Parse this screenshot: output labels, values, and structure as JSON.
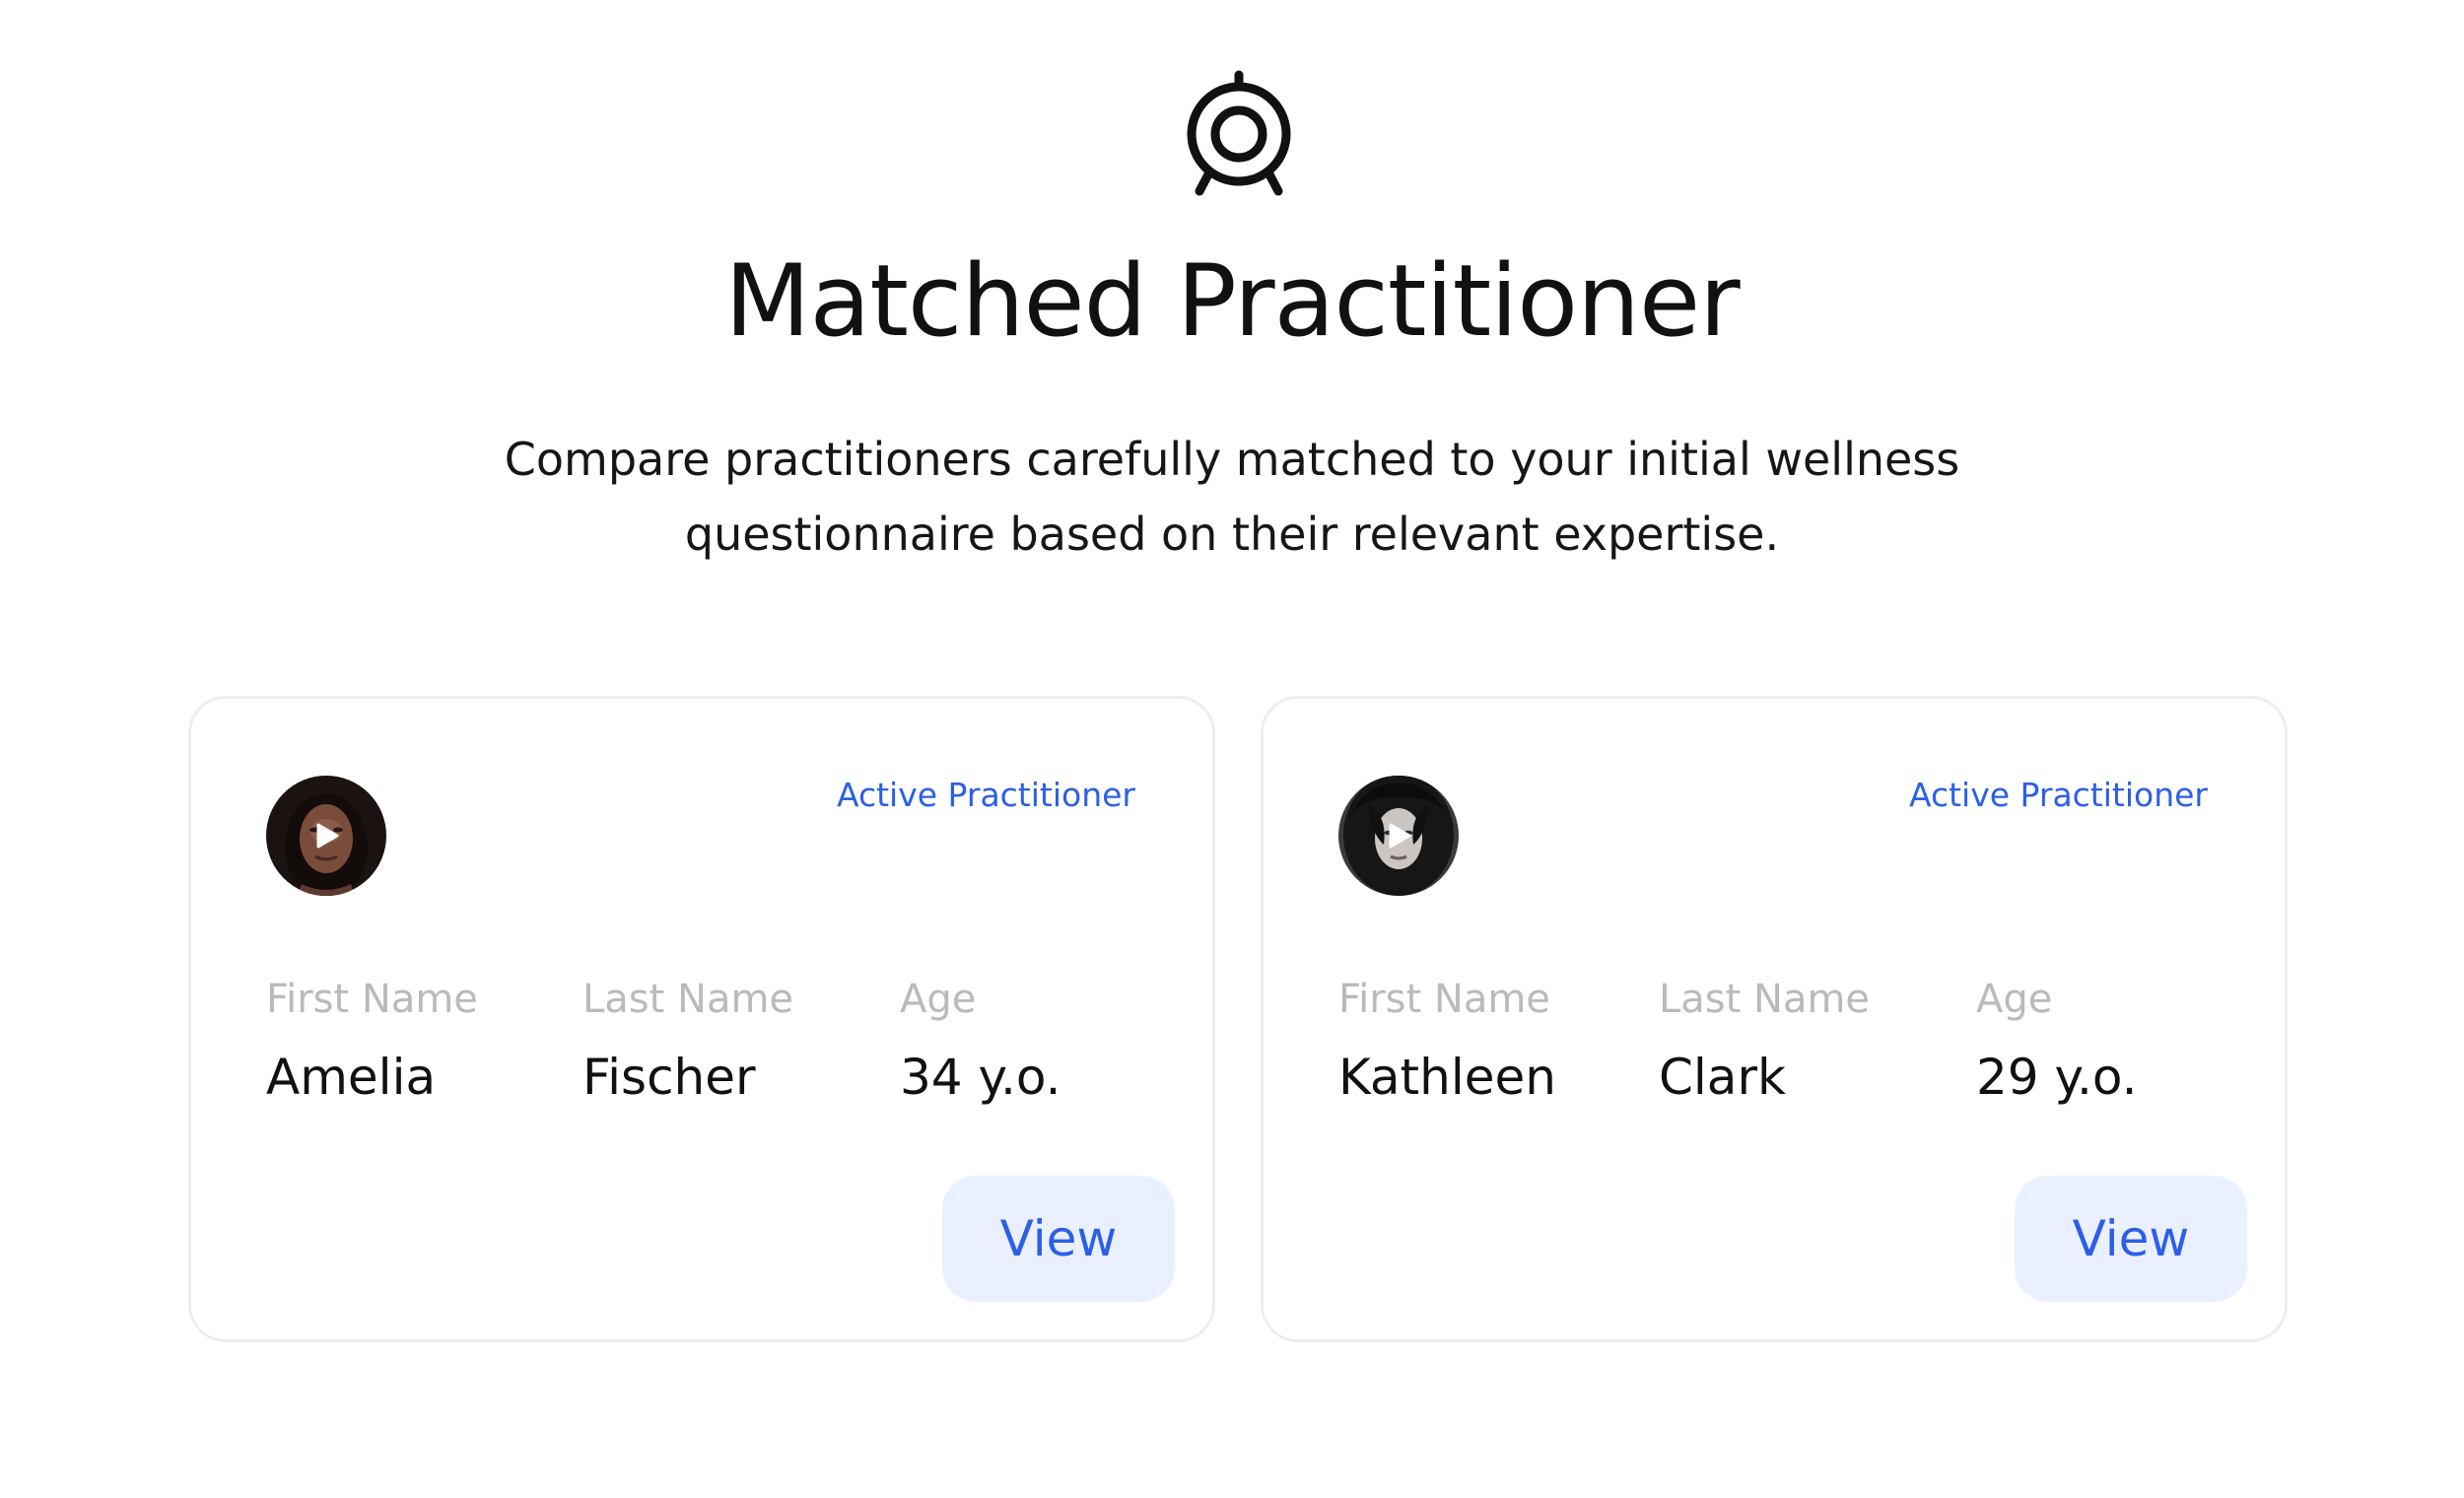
{
  "header": {
    "logo_icon": "target-stand-icon",
    "title": "Matched Practitioner",
    "subtitle": "Compare practitioners carefully matched to your initial wellness questionnaire based on their relevant expertise."
  },
  "colors": {
    "accent": "#2c5fe8",
    "button_bg": "#eaf0ff",
    "label_gray": "#b9b9bf",
    "card_border": "#eeeeef"
  },
  "practitioners": [
    {
      "avatar_icon": "play-icon",
      "status": "Active Practitioner",
      "first_name_label": "First Name",
      "last_name_label": "Last Name",
      "age_label": "Age",
      "first_name": "Amelia",
      "last_name": "Fischer",
      "age": "34 y.o.",
      "view_label": "View"
    },
    {
      "avatar_icon": "play-icon",
      "status": "Active Practitioner",
      "first_name_label": "First Name",
      "last_name_label": "Last Name",
      "age_label": "Age",
      "first_name": "Kathleen",
      "last_name": "Clark",
      "age": "29 y.o.",
      "view_label": "View"
    }
  ]
}
